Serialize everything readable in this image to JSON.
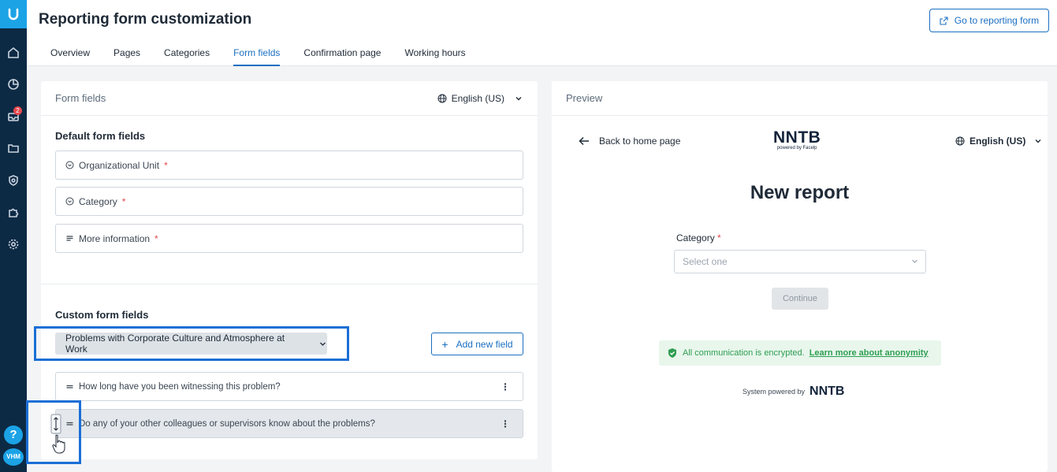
{
  "sidebar": {
    "badge_count": "2",
    "help_label": "?",
    "avatar_label": "VHM"
  },
  "header": {
    "title": "Reporting form customization",
    "go_button": "Go to reporting form",
    "tabs": [
      "Overview",
      "Pages",
      "Categories",
      "Form fields",
      "Confirmation page",
      "Working hours"
    ],
    "active_tab": "Form fields"
  },
  "form_fields": {
    "panel_title": "Form fields",
    "language": "English (US)",
    "default_title": "Default form fields",
    "default_fields": [
      {
        "label": "Organizational Unit",
        "required": "*"
      },
      {
        "label": "Category",
        "required": "*"
      },
      {
        "label": "More information",
        "required": "*"
      }
    ],
    "custom_title": "Custom form fields",
    "category_select": "Problems with Corporate Culture and Atmosphere at Work",
    "add_button": "Add new field",
    "questions": [
      "How long have you been witnessing this problem?",
      "Do any of your other colleagues or supervisors know about the problems?"
    ]
  },
  "preview": {
    "panel_title": "Preview",
    "back_label": "Back to home page",
    "brand": "NNTB",
    "brand_sub": "powered by Facelp",
    "language": "English (US)",
    "heading": "New report",
    "category_label": "Category",
    "required": "*",
    "select_placeholder": "Select one",
    "continue_label": "Continue",
    "encrypted_text": "All communication is encrypted.",
    "anonymity_link": "Learn more about anonymity",
    "powered_by": "System powered by"
  },
  "colors": {
    "accent": "#1b6fc2",
    "sidebar_bg": "#0d2a45",
    "highlight": "#1b6fd6",
    "success": "#2e9e52"
  }
}
